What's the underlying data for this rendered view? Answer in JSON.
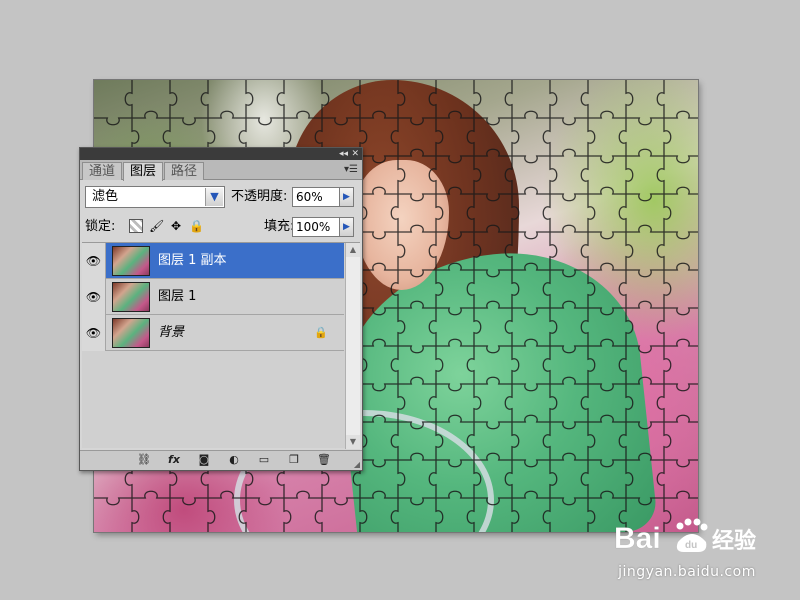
{
  "panel": {
    "tabs": [
      {
        "label": "通道",
        "active": false
      },
      {
        "label": "图层",
        "active": true
      },
      {
        "label": "路径",
        "active": false
      }
    ],
    "blend_mode": "滤色",
    "opacity_label": "不透明度:",
    "opacity_value": "60%",
    "lock_label": "锁定:",
    "fill_label": "填充:",
    "fill_value": "100%",
    "layers": [
      {
        "name": "图层 1 副本",
        "selected": true,
        "locked": false
      },
      {
        "name": "图层 1",
        "selected": false,
        "locked": false
      },
      {
        "name": "背景",
        "selected": false,
        "locked": true
      }
    ],
    "bottom_icons": [
      "link-icon",
      "fx-icon",
      "mask-icon",
      "adjustment-icon",
      "folder-icon",
      "new-layer-icon",
      "trash-icon"
    ]
  },
  "watermark": {
    "logo_text": "Bai du 经验",
    "url": "jingyan.baidu.com"
  },
  "colors": {
    "selection": "#3b6fc9",
    "panel_bg": "#d6d6d6",
    "workspace": "#c4c4c4",
    "arrow_blue": "#2456b8"
  }
}
